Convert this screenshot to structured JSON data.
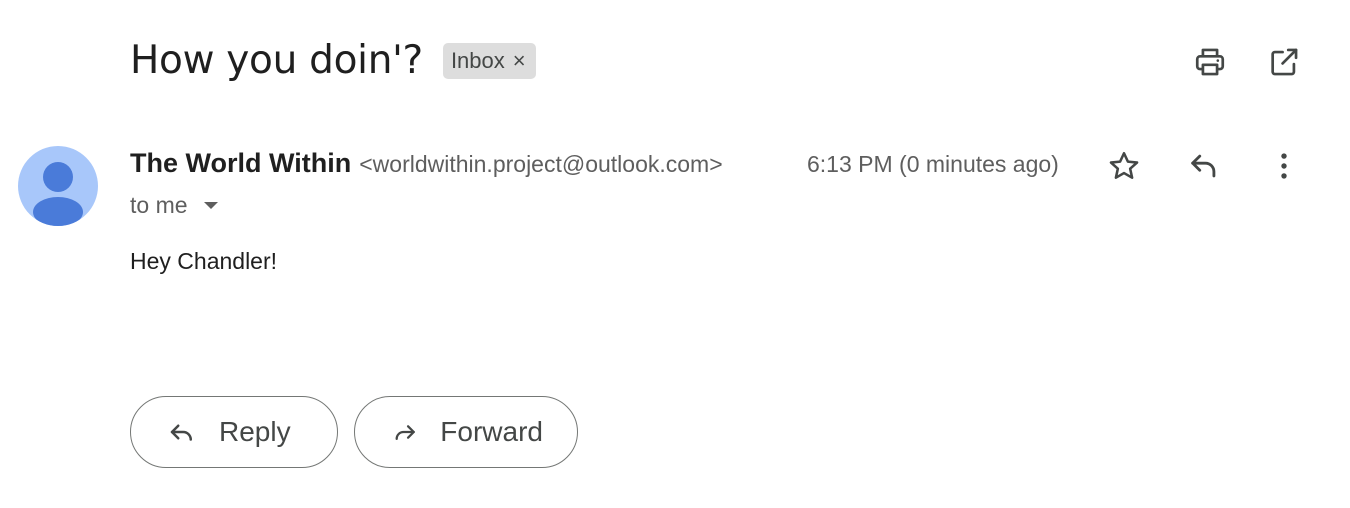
{
  "email": {
    "subject": "How you doin'?",
    "label": {
      "text": "Inbox",
      "remove_glyph": "×"
    },
    "sender": {
      "name": "The World Within",
      "email": "<worldwithin.project@outlook.com>"
    },
    "recipient_text": "to me",
    "timestamp": "6:13 PM (0 minutes ago)",
    "body": "Hey Chandler!"
  },
  "actions": {
    "reply_label": "Reply",
    "forward_label": "Forward"
  },
  "icons": {
    "print": "print-icon",
    "open_new_window": "open-in-new-window-icon",
    "star": "star-icon",
    "reply": "reply-icon",
    "more": "more-vertical-icon",
    "avatar": "default-avatar-icon"
  },
  "colors": {
    "avatar_bg": "#a8c7fa",
    "avatar_fg": "#4a7bd9",
    "label_chip_bg": "#dddddd",
    "button_border": "#747775"
  }
}
